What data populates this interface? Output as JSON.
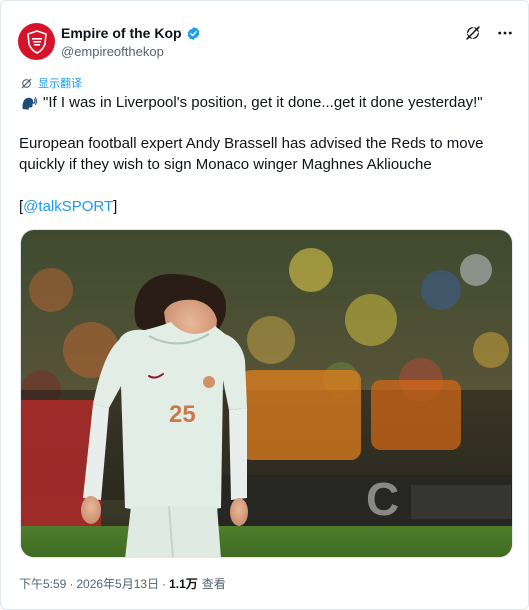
{
  "author": {
    "display_name": "Empire of the Kop",
    "handle": "@empireofthekop",
    "verified": true,
    "brand_color": "#d5142b",
    "verified_color": "#1d9bf0"
  },
  "actions": {
    "grok_icon": "grok-icon",
    "more_icon": "more-icon"
  },
  "translate": {
    "label": "显示翻译",
    "icon": "translate-icon"
  },
  "tweet": {
    "emoji": "speaking-head-icon",
    "quote": "\"If I was in Liverpool's position, get it done...get it done yesterday!\"",
    "body": "European football expert Andy Brassell has advised the Reds to move quickly if they wish to sign Monaco winger Maghnes Akliouche",
    "mention_open": "[",
    "mention": "@talkSPORT",
    "mention_close": "]"
  },
  "media": {
    "shirt_number": "25"
  },
  "meta": {
    "time": "下午5:59",
    "separator": "·",
    "date": "2026年5月13日",
    "views": "1.1万",
    "views_label": "查看"
  }
}
